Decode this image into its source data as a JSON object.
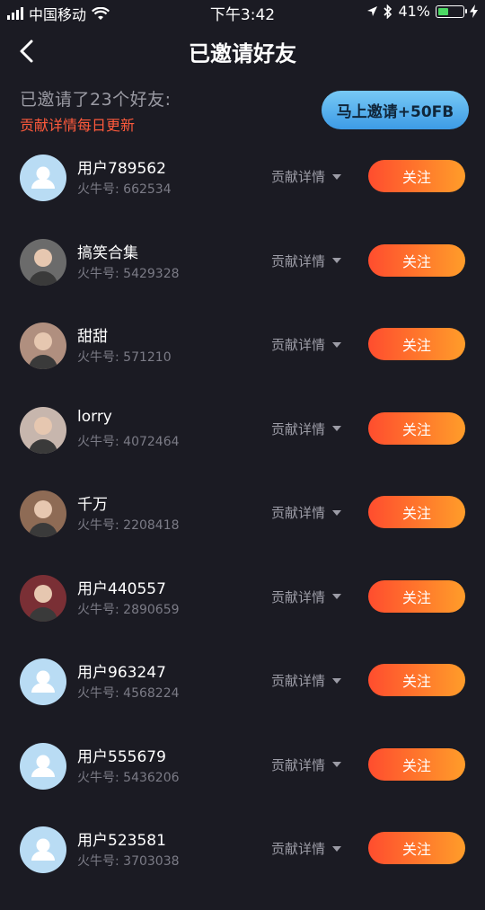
{
  "status_bar": {
    "carrier": "中国移动",
    "time": "下午3:42",
    "battery": "41%",
    "battery_level": 0.41
  },
  "header": {
    "title": "已邀请好友",
    "back_icon": "chevron-left-icon"
  },
  "summary": {
    "count_text": "已邀请了23个好友:",
    "note": "贡献详情每日更新"
  },
  "invite_button": "马上邀请+50FB",
  "list": [
    {
      "name": "用户789562",
      "uid": "火牛号: 662534",
      "detail": "贡献详情",
      "action": "关注",
      "avatar": "default-avatar",
      "avatar_color": "#b9dcf4"
    },
    {
      "name": "搞笑合集",
      "uid": "火牛号: 5429328",
      "detail": "贡献详情",
      "action": "关注",
      "avatar": "photo",
      "avatar_color": "#6b6b6b"
    },
    {
      "name": "甜甜",
      "uid": "火牛号: 571210",
      "detail": "贡献详情",
      "action": "关注",
      "avatar": "photo",
      "avatar_color": "#b08f7f"
    },
    {
      "name": "lorry",
      "uid": "火牛号: 4072464",
      "detail": "贡献详情",
      "action": "关注",
      "avatar": "photo",
      "avatar_color": "#c7b6ad"
    },
    {
      "name": "千万",
      "uid": "火牛号: 2208418",
      "detail": "贡献详情",
      "action": "关注",
      "avatar": "photo",
      "avatar_color": "#8e6b55"
    },
    {
      "name": "用户440557",
      "uid": "火牛号: 2890659",
      "detail": "贡献详情",
      "action": "关注",
      "avatar": "photo",
      "avatar_color": "#7a2f35"
    },
    {
      "name": "用户963247",
      "uid": "火牛号: 4568224",
      "detail": "贡献详情",
      "action": "关注",
      "avatar": "default-avatar",
      "avatar_color": "#b9dcf4"
    },
    {
      "name": "用户555679",
      "uid": "火牛号: 5436206",
      "detail": "贡献详情",
      "action": "关注",
      "avatar": "default-avatar",
      "avatar_color": "#b9dcf4"
    },
    {
      "name": "用户523581",
      "uid": "火牛号: 3703038",
      "detail": "贡献详情",
      "action": "关注",
      "avatar": "default-avatar",
      "avatar_color": "#b9dcf4"
    }
  ]
}
